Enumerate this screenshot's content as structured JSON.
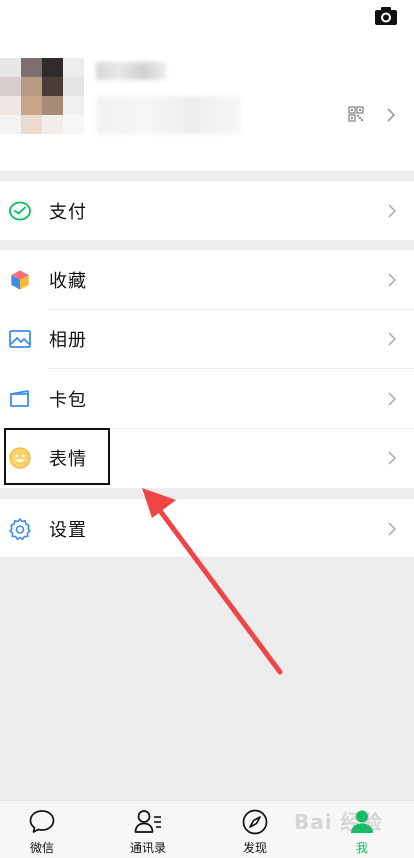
{
  "profile": {
    "camera_icon": "camera-icon",
    "qr_icon": "qr-code-icon"
  },
  "menu": {
    "pay": {
      "label": "支付",
      "icon": "pay-icon"
    },
    "items": [
      {
        "label": "收藏",
        "icon": "favorites-cube-icon"
      },
      {
        "label": "相册",
        "icon": "album-icon"
      },
      {
        "label": "卡包",
        "icon": "card-wallet-icon"
      },
      {
        "label": "表情",
        "icon": "sticker-smile-icon"
      }
    ],
    "settings": {
      "label": "设置",
      "icon": "gear-icon"
    }
  },
  "tabbar": {
    "tabs": [
      {
        "label": "微信",
        "icon": "chat-bubble-icon"
      },
      {
        "label": "通讯录",
        "icon": "contacts-icon"
      },
      {
        "label": "发现",
        "icon": "compass-icon"
      },
      {
        "label": "我",
        "icon": "me-person-icon"
      }
    ],
    "active_index": 3,
    "active_color": "#07c160"
  },
  "watermark": {
    "text": "Bai 经验"
  }
}
